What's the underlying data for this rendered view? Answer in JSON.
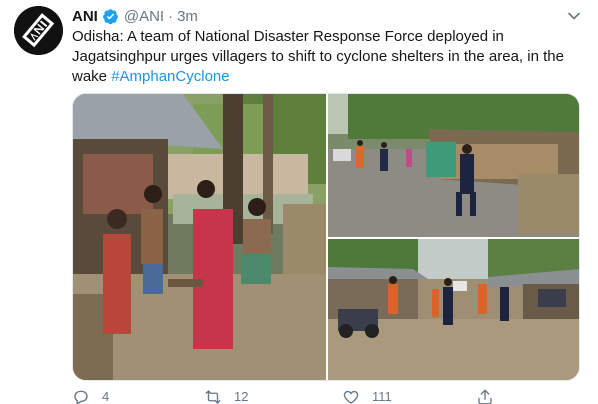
{
  "tweet": {
    "author_name": "ANI",
    "handle": "@ANI",
    "separator": "·",
    "time": "3m",
    "text_line1": "Odisha: A team of National Disaster Response Force deployed in",
    "text_line2": "Jagatsinghpur urges villagers to shift to cyclone shelters in the area, in the",
    "text_line3_prefix": "wake ",
    "hashtag": "#AmphanCyclone",
    "reply_count": "4",
    "retweet_count": "12",
    "like_count": "111"
  },
  "icons": {
    "avatar": "ani-logo-avatar",
    "verified": "verified-badge-icon",
    "caret": "chevron-down-icon",
    "reply": "reply-icon",
    "retweet": "retweet-icon",
    "like": "heart-icon",
    "share": "share-icon"
  },
  "colors": {
    "link": "#1b95e0",
    "muted": "#657786",
    "verified": "#1da1f2"
  }
}
